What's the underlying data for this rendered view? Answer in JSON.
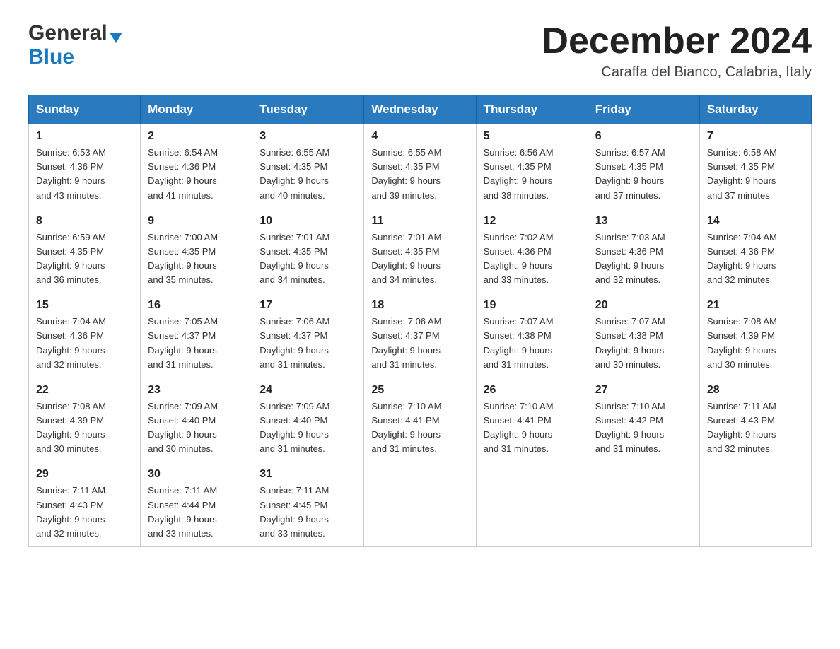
{
  "header": {
    "logo_general": "General",
    "logo_blue": "Blue",
    "month_title": "December 2024",
    "subtitle": "Caraffa del Bianco, Calabria, Italy"
  },
  "weekdays": [
    "Sunday",
    "Monday",
    "Tuesday",
    "Wednesday",
    "Thursday",
    "Friday",
    "Saturday"
  ],
  "weeks": [
    [
      {
        "day": "1",
        "sunrise": "6:53 AM",
        "sunset": "4:36 PM",
        "daylight": "9 hours and 43 minutes."
      },
      {
        "day": "2",
        "sunrise": "6:54 AM",
        "sunset": "4:36 PM",
        "daylight": "9 hours and 41 minutes."
      },
      {
        "day": "3",
        "sunrise": "6:55 AM",
        "sunset": "4:35 PM",
        "daylight": "9 hours and 40 minutes."
      },
      {
        "day": "4",
        "sunrise": "6:55 AM",
        "sunset": "4:35 PM",
        "daylight": "9 hours and 39 minutes."
      },
      {
        "day": "5",
        "sunrise": "6:56 AM",
        "sunset": "4:35 PM",
        "daylight": "9 hours and 38 minutes."
      },
      {
        "day": "6",
        "sunrise": "6:57 AM",
        "sunset": "4:35 PM",
        "daylight": "9 hours and 37 minutes."
      },
      {
        "day": "7",
        "sunrise": "6:58 AM",
        "sunset": "4:35 PM",
        "daylight": "9 hours and 37 minutes."
      }
    ],
    [
      {
        "day": "8",
        "sunrise": "6:59 AM",
        "sunset": "4:35 PM",
        "daylight": "9 hours and 36 minutes."
      },
      {
        "day": "9",
        "sunrise": "7:00 AM",
        "sunset": "4:35 PM",
        "daylight": "9 hours and 35 minutes."
      },
      {
        "day": "10",
        "sunrise": "7:01 AM",
        "sunset": "4:35 PM",
        "daylight": "9 hours and 34 minutes."
      },
      {
        "day": "11",
        "sunrise": "7:01 AM",
        "sunset": "4:35 PM",
        "daylight": "9 hours and 34 minutes."
      },
      {
        "day": "12",
        "sunrise": "7:02 AM",
        "sunset": "4:36 PM",
        "daylight": "9 hours and 33 minutes."
      },
      {
        "day": "13",
        "sunrise": "7:03 AM",
        "sunset": "4:36 PM",
        "daylight": "9 hours and 32 minutes."
      },
      {
        "day": "14",
        "sunrise": "7:04 AM",
        "sunset": "4:36 PM",
        "daylight": "9 hours and 32 minutes."
      }
    ],
    [
      {
        "day": "15",
        "sunrise": "7:04 AM",
        "sunset": "4:36 PM",
        "daylight": "9 hours and 32 minutes."
      },
      {
        "day": "16",
        "sunrise": "7:05 AM",
        "sunset": "4:37 PM",
        "daylight": "9 hours and 31 minutes."
      },
      {
        "day": "17",
        "sunrise": "7:06 AM",
        "sunset": "4:37 PM",
        "daylight": "9 hours and 31 minutes."
      },
      {
        "day": "18",
        "sunrise": "7:06 AM",
        "sunset": "4:37 PM",
        "daylight": "9 hours and 31 minutes."
      },
      {
        "day": "19",
        "sunrise": "7:07 AM",
        "sunset": "4:38 PM",
        "daylight": "9 hours and 31 minutes."
      },
      {
        "day": "20",
        "sunrise": "7:07 AM",
        "sunset": "4:38 PM",
        "daylight": "9 hours and 30 minutes."
      },
      {
        "day": "21",
        "sunrise": "7:08 AM",
        "sunset": "4:39 PM",
        "daylight": "9 hours and 30 minutes."
      }
    ],
    [
      {
        "day": "22",
        "sunrise": "7:08 AM",
        "sunset": "4:39 PM",
        "daylight": "9 hours and 30 minutes."
      },
      {
        "day": "23",
        "sunrise": "7:09 AM",
        "sunset": "4:40 PM",
        "daylight": "9 hours and 30 minutes."
      },
      {
        "day": "24",
        "sunrise": "7:09 AM",
        "sunset": "4:40 PM",
        "daylight": "9 hours and 31 minutes."
      },
      {
        "day": "25",
        "sunrise": "7:10 AM",
        "sunset": "4:41 PM",
        "daylight": "9 hours and 31 minutes."
      },
      {
        "day": "26",
        "sunrise": "7:10 AM",
        "sunset": "4:41 PM",
        "daylight": "9 hours and 31 minutes."
      },
      {
        "day": "27",
        "sunrise": "7:10 AM",
        "sunset": "4:42 PM",
        "daylight": "9 hours and 31 minutes."
      },
      {
        "day": "28",
        "sunrise": "7:11 AM",
        "sunset": "4:43 PM",
        "daylight": "9 hours and 32 minutes."
      }
    ],
    [
      {
        "day": "29",
        "sunrise": "7:11 AM",
        "sunset": "4:43 PM",
        "daylight": "9 hours and 32 minutes."
      },
      {
        "day": "30",
        "sunrise": "7:11 AM",
        "sunset": "4:44 PM",
        "daylight": "9 hours and 33 minutes."
      },
      {
        "day": "31",
        "sunrise": "7:11 AM",
        "sunset": "4:45 PM",
        "daylight": "9 hours and 33 minutes."
      },
      null,
      null,
      null,
      null
    ]
  ],
  "labels": {
    "sunrise": "Sunrise:",
    "sunset": "Sunset:",
    "daylight": "Daylight:"
  }
}
